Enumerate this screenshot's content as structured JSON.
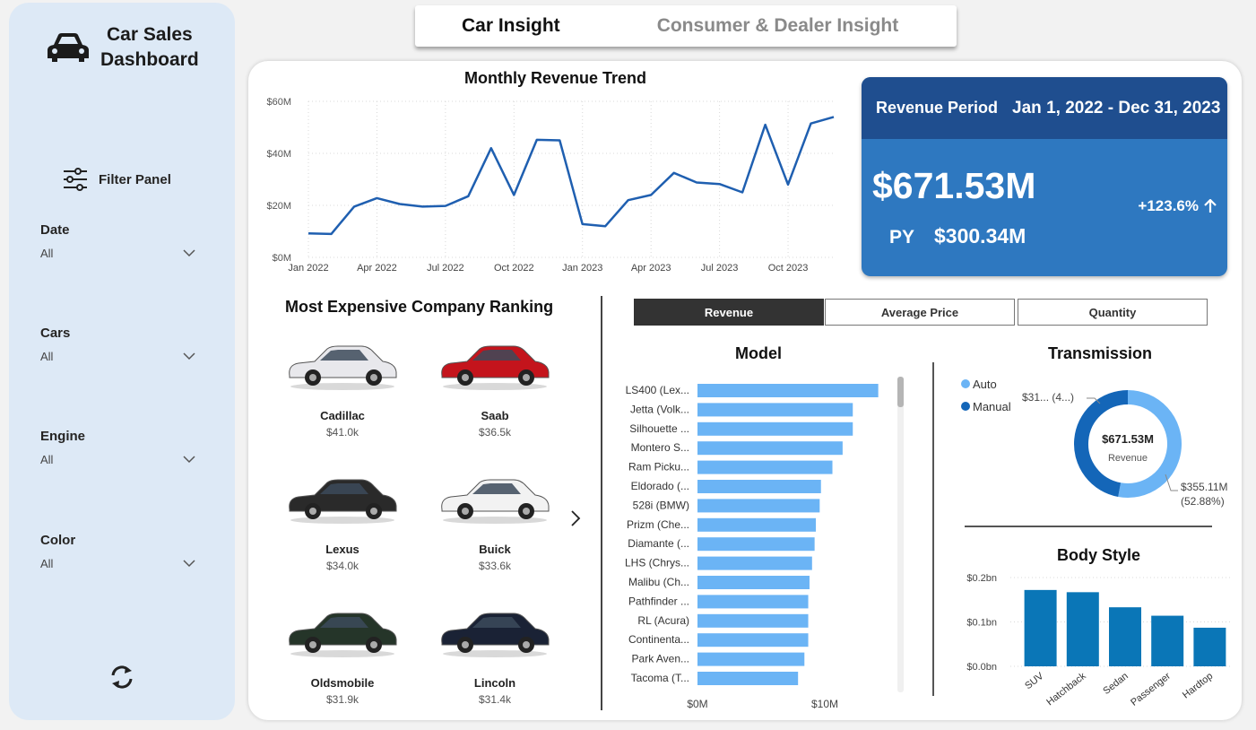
{
  "sidebar": {
    "title_line1": "Car Sales",
    "title_line2": "Dashboard",
    "filter_panel_label": "Filter Panel",
    "slicers": [
      {
        "label": "Date",
        "value": "All"
      },
      {
        "label": "Cars",
        "value": "All"
      },
      {
        "label": "Engine",
        "value": "All"
      },
      {
        "label": "Color",
        "value": "All"
      }
    ]
  },
  "tabs": [
    {
      "label": "Car Insight",
      "active": true
    },
    {
      "label": "Consumer & Dealer Insight",
      "active": false
    }
  ],
  "revenue_trend": {
    "title": "Monthly Revenue Trend",
    "chart_data": {
      "type": "line",
      "x": [
        "Jan 2022",
        "Feb 2022",
        "Mar 2022",
        "Apr 2022",
        "May 2022",
        "Jun 2022",
        "Jul 2022",
        "Aug 2022",
        "Sep 2022",
        "Oct 2022",
        "Nov 2022",
        "Dec 2022",
        "Jan 2023",
        "Feb 2023",
        "Mar 2023",
        "Apr 2023",
        "May 2023",
        "Jun 2023",
        "Jul 2023",
        "Aug 2023",
        "Sep 2023",
        "Oct 2023",
        "Nov 2023",
        "Dec 2023"
      ],
      "values": [
        9.2,
        9.0,
        19.5,
        22.8,
        20.5,
        19.5,
        19.8,
        23.5,
        42.0,
        24.0,
        45.2,
        45.0,
        12.8,
        12.0,
        22.0,
        24.0,
        32.5,
        28.8,
        28.2,
        25.0,
        51.0,
        28.0,
        51.5,
        54.0
      ],
      "x_tick_labels": [
        "Jan 2022",
        "Apr 2022",
        "Jul 2022",
        "Oct 2022",
        "Jan 2023",
        "Apr 2023",
        "Jul 2023",
        "Oct 2023"
      ],
      "y_tick_labels": [
        "$0M",
        "$20M",
        "$40M",
        "$60M"
      ],
      "ylim": [
        0,
        60
      ],
      "grid": true,
      "color": "#1f5fb0"
    }
  },
  "kpi": {
    "period_label": "Revenue Period",
    "period_value": "Jan 1, 2022 - Dec 31, 2023",
    "revenue": "$671.53M",
    "change": "+123.6%",
    "py_label": "PY",
    "py_value": "$300.34M"
  },
  "ranking": {
    "title": "Most Expensive Company Ranking",
    "companies": [
      {
        "name": "Cadillac",
        "price": "$41.0k",
        "color": "#e8e8ec"
      },
      {
        "name": "Saab",
        "price": "$36.5k",
        "color": "#c4141c"
      },
      {
        "name": "Lexus",
        "price": "$34.0k",
        "color": "#2a2a2a"
      },
      {
        "name": "Buick",
        "price": "$33.6k",
        "color": "#f2f2f2"
      },
      {
        "name": "Oldsmobile",
        "price": "$31.9k",
        "color": "#253529"
      },
      {
        "name": "Lincoln",
        "price": "$31.4k",
        "color": "#1a2235"
      }
    ]
  },
  "metric_buttons": [
    {
      "label": "Revenue",
      "active": true
    },
    {
      "label": "Average Price",
      "active": false
    },
    {
      "label": "Quantity",
      "active": false
    }
  ],
  "model_chart": {
    "title": "Model",
    "chart_data": {
      "type": "bar",
      "orientation": "horizontal",
      "categories": [
        "LS400 (Lex...",
        "Jetta (Volk...",
        "Silhouette ...",
        "Montero S...",
        "Ram Picku...",
        "Eldorado (...",
        "528i (BMW)",
        "Prizm (Che...",
        "Diamante (...",
        "LHS (Chrys...",
        "Malibu (Ch...",
        "Pathfinder ...",
        "RL (Acura)",
        "Continenta...",
        "Park Aven...",
        "Tacoma (T..."
      ],
      "values": [
        14.2,
        12.2,
        12.2,
        11.4,
        10.6,
        9.7,
        9.6,
        9.3,
        9.2,
        9.0,
        8.8,
        8.7,
        8.7,
        8.7,
        8.4,
        7.9
      ],
      "x_tick_labels": [
        "$0M",
        "$10M"
      ],
      "color": "#6bb4f5"
    }
  },
  "transmission": {
    "title": "Transmission",
    "legend": [
      {
        "name": "Auto",
        "color": "#6bb4f5"
      },
      {
        "name": "Manual",
        "color": "#1466b8"
      }
    ],
    "center_value": "$671.53M",
    "center_label": "Revenue",
    "label_small": "$31... (4...)",
    "label_large_value": "$355.11M",
    "label_large_pct": "(52.88%)",
    "chart_data": {
      "type": "pie",
      "categories": [
        "Auto",
        "Manual"
      ],
      "values": [
        355.11,
        316.42
      ]
    }
  },
  "body_style": {
    "title": "Body Style",
    "chart_data": {
      "type": "bar",
      "categories": [
        "SUV",
        "Hatchback",
        "Sedan",
        "Passenger",
        "Hardtop"
      ],
      "values": [
        0.172,
        0.167,
        0.133,
        0.114,
        0.087
      ],
      "y_tick_labels": [
        "$0.0bn",
        "$0.1bn",
        "$0.2bn"
      ],
      "ylim": [
        0,
        0.2
      ],
      "color": "#0a76b7"
    }
  }
}
